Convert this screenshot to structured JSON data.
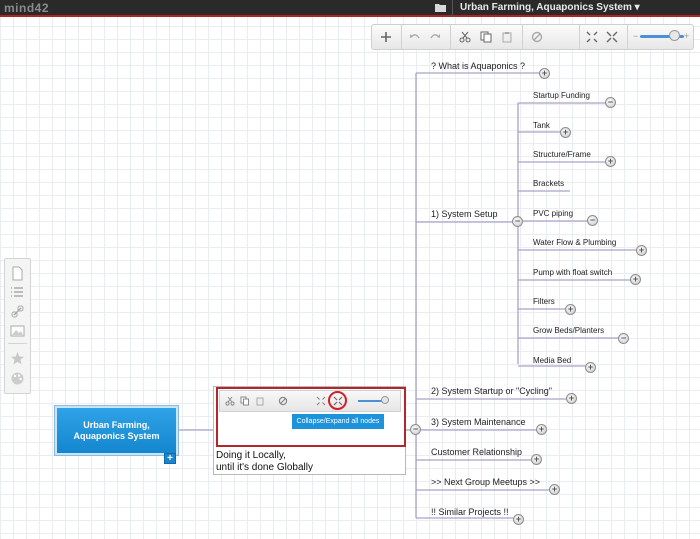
{
  "app": {
    "logo": "mind42"
  },
  "header": {
    "title": "Urban Farming, Aquaponics System ▾"
  },
  "root": {
    "line1": "Urban Farming,",
    "line2": "Aquaponics System"
  },
  "callout": {
    "tooltip": "Collapse/Expand all nodes",
    "line1": "Doing it Locally,",
    "line2": "until it's done Globally"
  },
  "nodes": {
    "what": "? What is Aquaponics ?",
    "setup": "1) System Setup",
    "startup": "2) System Startup or \"Cycling\"",
    "maint": "3) System Maintenance",
    "customer": "Customer Relationship",
    "meetups": ">> Next Group Meetups >>",
    "similar": "!! Similar Projects !!"
  },
  "subnodes": [
    "Startup Funding",
    "Tank",
    "Structure/Frame",
    "Brackets",
    "PVC piping",
    "Water Flow & Plumbing",
    "Pump with float switch",
    "Filters",
    "Grow Beds/Planters",
    "Media Bed"
  ],
  "icons": {
    "add": "plus-icon",
    "undo": "undo-icon",
    "redo": "redo-icon",
    "cut": "scissors-icon",
    "copy": "copy-icon",
    "paste": "paste-icon",
    "noop": "disabled-icon",
    "fit": "fit-to-screen-icon",
    "collapse": "collapse-all-icon"
  },
  "colors": {
    "accent": "#1d93dc",
    "highlight": "#b3262a",
    "topbar": "#2a2a2a"
  }
}
